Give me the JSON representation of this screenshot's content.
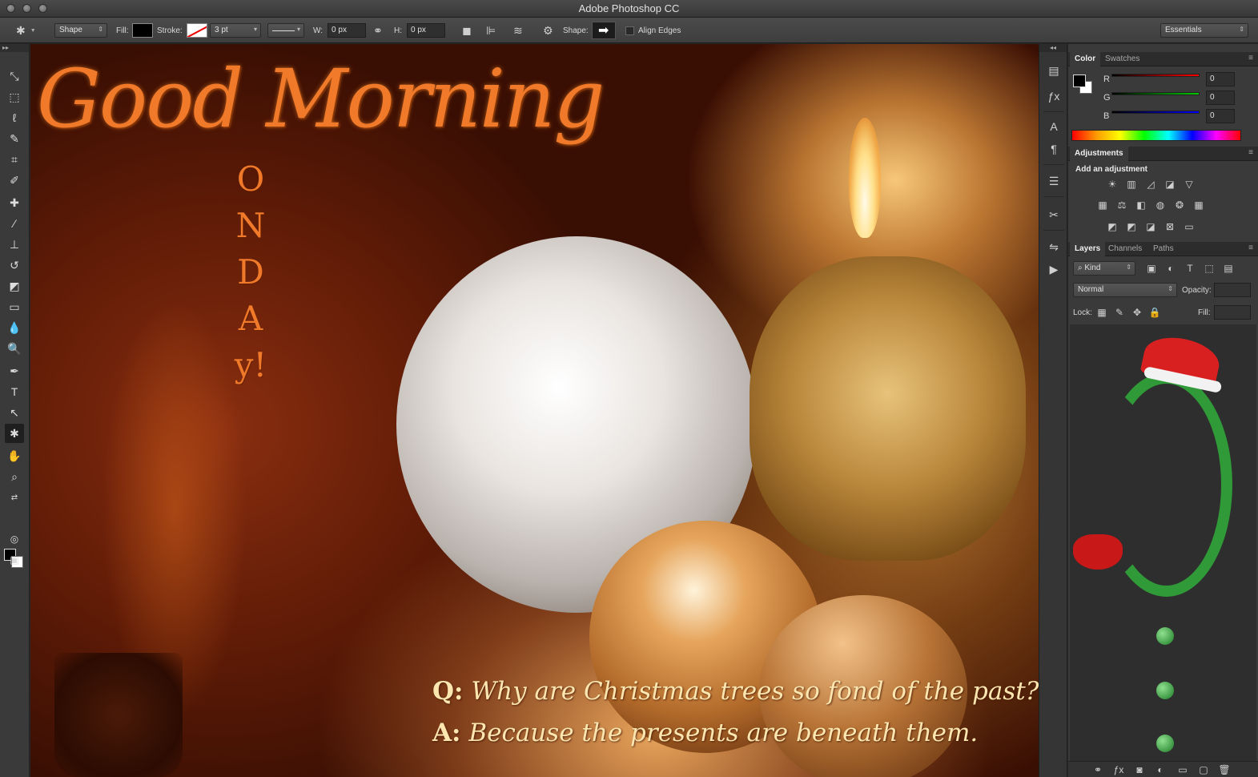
{
  "app": {
    "title": "Adobe Photoshop CC"
  },
  "options_bar": {
    "tool_mode": "Shape",
    "fill_label": "Fill:",
    "stroke_label": "Stroke:",
    "stroke_width": "3 pt",
    "w_label": "W:",
    "w_value": "0 px",
    "h_label": "H:",
    "h_value": "0 px",
    "shape_label": "Shape:",
    "align_edges_label": "Align Edges",
    "workspace": "Essentials"
  },
  "tools": [
    "move-tool",
    "marquee-tool",
    "lasso-tool",
    "quick-selection-tool",
    "crop-tool",
    "eyedropper-tool",
    "healing-brush-tool",
    "brush-tool",
    "clone-stamp-tool",
    "history-brush-tool",
    "eraser-tool",
    "gradient-tool",
    "blur-tool",
    "dodge-tool",
    "pen-tool",
    "type-tool",
    "path-selection-tool",
    "custom-shape-tool",
    "hand-tool",
    "zoom-tool"
  ],
  "canvas": {
    "headline": "Good Morning",
    "vertical_letters": [
      "O",
      "N",
      "D",
      "A",
      "y!"
    ],
    "question_prefix": "Q:",
    "question": "Why are Christmas trees so fond of the past?",
    "answer_prefix": "A:",
    "answer": "Because the presents are beneath them."
  },
  "color_panel": {
    "tabs": [
      "Color",
      "Swatches"
    ],
    "active_tab": "Color",
    "channels": [
      {
        "label": "R",
        "value": "0",
        "color": "#e02020"
      },
      {
        "label": "G",
        "value": "0",
        "color": "#20c020"
      },
      {
        "label": "B",
        "value": "0",
        "color": "#2040e0"
      }
    ]
  },
  "adjustments_panel": {
    "tab": "Adjustments",
    "heading": "Add an adjustment"
  },
  "layers_panel": {
    "tabs": [
      "Layers",
      "Channels",
      "Paths"
    ],
    "active_tab": "Layers",
    "filter_kind": "Kind",
    "blend_mode": "Normal",
    "opacity_label": "Opacity:",
    "lock_label": "Lock:",
    "fill_label": "Fill:"
  }
}
